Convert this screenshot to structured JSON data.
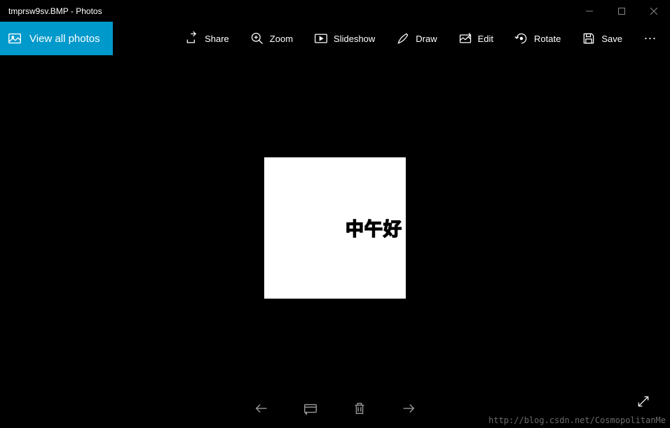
{
  "window": {
    "title": "tmprsw9sv.BMP - Photos"
  },
  "toolbar": {
    "view_all_label": "View all photos",
    "share_label": "Share",
    "zoom_label": "Zoom",
    "slideshow_label": "Slideshow",
    "draw_label": "Draw",
    "edit_label": "Edit",
    "rotate_label": "Rotate",
    "save_label": "Save"
  },
  "image": {
    "text": "中午好"
  },
  "watermark": "http://blog.csdn.net/CosmopolitanMe"
}
